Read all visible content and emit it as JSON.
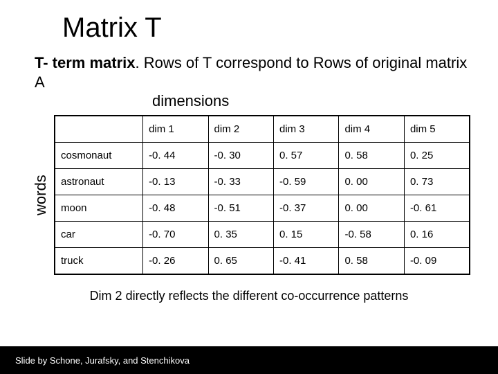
{
  "title": "Matrix T",
  "desc_bold": "T- term matrix",
  "desc_rest": ". Rows of T correspond to Rows of  original matrix A",
  "desc_dim": "dimensions",
  "side_label": "words",
  "note": "Dim 2 directly reflects the different co-occurrence patterns",
  "footer": "Slide by Schone, Jurafsky, and Stenchikova",
  "chart_data": {
    "type": "table",
    "columns": [
      "",
      "dim 1",
      "dim 2",
      "dim 3",
      "dim 4",
      "dim 5"
    ],
    "rows": [
      [
        "cosmonaut",
        "-0. 44",
        "-0. 30",
        "0. 57",
        "0. 58",
        "0. 25"
      ],
      [
        "astronaut",
        "-0. 13",
        "-0. 33",
        "-0. 59",
        "0. 00",
        "0. 73"
      ],
      [
        "moon",
        "-0. 48",
        "-0. 51",
        "-0. 37",
        "0. 00",
        "-0. 61"
      ],
      [
        "car",
        "-0. 70",
        "0. 35",
        "0. 15",
        "-0. 58",
        "0. 16"
      ],
      [
        "truck",
        "-0. 26",
        "0. 65",
        "-0. 41",
        "0. 58",
        "-0. 09"
      ]
    ]
  }
}
